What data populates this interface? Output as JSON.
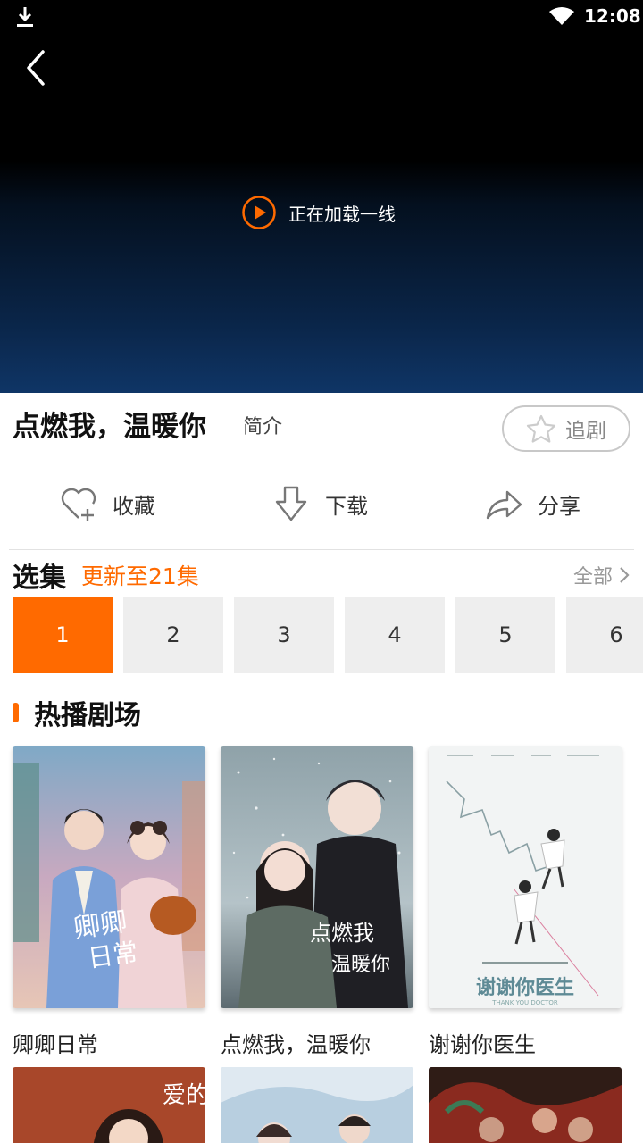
{
  "status_bar": {
    "time": "12:08"
  },
  "player": {
    "loading_text": "正在加载一线"
  },
  "show": {
    "title": "点燃我，温暖你",
    "intro_label": "简介",
    "follow_label": "追剧"
  },
  "actions": {
    "favorite": "收藏",
    "download": "下载",
    "share": "分享"
  },
  "episodes": {
    "heading": "选集",
    "update_text": "更新至21集",
    "all_label": "全部",
    "items": [
      "1",
      "2",
      "3",
      "4",
      "5",
      "6"
    ],
    "selected": "1"
  },
  "hot": {
    "heading": "热播剧场",
    "items": [
      {
        "title": "卿卿日常",
        "poster_text": "卿卿日常"
      },
      {
        "title": "点燃我，温暖你",
        "poster_text": "点燃我 温暖你"
      },
      {
        "title": "谢谢你医生",
        "poster_text": "谢谢你医生",
        "poster_subtext": "THANK YOU DOCTOR"
      }
    ],
    "row2": [
      {
        "poster_text": "爱的二八定律"
      },
      {
        "poster_text": ""
      },
      {
        "poster_text": ""
      }
    ]
  },
  "colors": {
    "accent": "#ff6a00",
    "episode_bg": "#eeeeee",
    "divider": "#e2e2e2"
  },
  "icons": {
    "status_download": "download-icon",
    "wifi": "wifi-icon",
    "back": "chevron-left-icon",
    "loading": "play-circle-icon",
    "follow": "star-icon",
    "favorite": "heart-plus-icon",
    "download": "download-arrow-icon",
    "share": "share-arrow-icon",
    "all": "chevron-right-icon"
  }
}
